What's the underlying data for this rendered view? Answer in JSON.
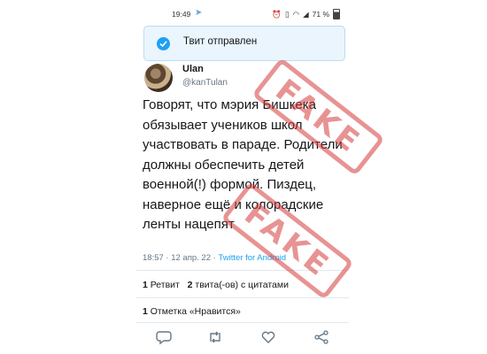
{
  "status_bar": {
    "time": "19:49",
    "battery": "71 %"
  },
  "toast": {
    "text": "Твит отправлен"
  },
  "tweet": {
    "author_name": "Ulan",
    "author_handle": "@kanTulan",
    "text": "Говорят, что мэрия Бишкека обязывает учеников школ участвовать в параде. Родители должны обеспечить детей военной(!) формой. Пиздец, наверное ещё и колорадские ленты нацепят",
    "time": "18:57",
    "date": "12 апр. 22",
    "source": "Twitter for Android",
    "retweets_count": "1",
    "retweets_label": "Ретвит",
    "quotes_count": "2",
    "quotes_label": "твита(-ов) с цитатами",
    "likes_count": "1",
    "likes_label": "Отметка «Нравится»"
  },
  "stamp_text": "FAKE",
  "icons": [
    "telegram-icon",
    "alarm-icon",
    "vibrate-icon",
    "wifi-icon",
    "signal-icon",
    "battery-icon",
    "check-icon",
    "reply-icon",
    "retweet-icon",
    "like-icon",
    "share-icon"
  ]
}
